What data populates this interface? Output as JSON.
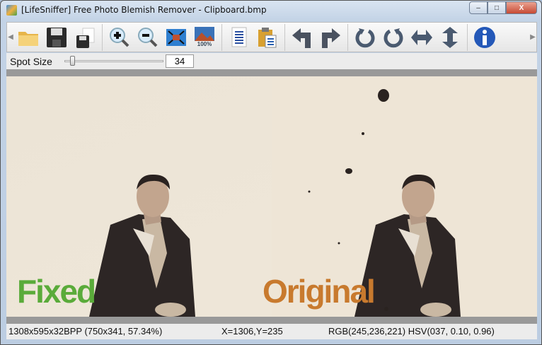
{
  "window": {
    "title": "[LifeSniffer]  Free Photo Blemish Remover - Clipboard.bmp",
    "minimize": "–",
    "maximize": "□",
    "close": "X"
  },
  "toolbar": {
    "items": [
      "open",
      "save",
      "save-as",
      "zoom-in",
      "zoom-out",
      "fit-window",
      "actual-size",
      "copy",
      "paste",
      "undo",
      "redo",
      "rotate-left",
      "rotate-right",
      "flip-horizontal",
      "flip-vertical",
      "about"
    ],
    "actual_size_label": "100%"
  },
  "spot": {
    "label": "Spot Size",
    "value": "34",
    "slider_fraction": 0.1
  },
  "photo": {
    "left_label": "Fixed",
    "right_label": "Original",
    "left_color": "#5aab3a",
    "right_color": "#c87a2e"
  },
  "status": {
    "image_info": "1308x595x32BPP (750x341, 57.34%)",
    "coords": "X=1306,Y=235",
    "color": "RGB(245,236,221) HSV(037, 0.10, 0.96)"
  }
}
